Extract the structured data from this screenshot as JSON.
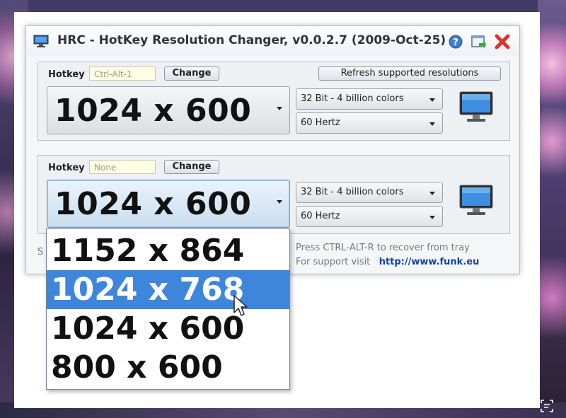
{
  "window": {
    "title": "HRC - HotKey Resolution Changer, v0.0.2.7 (2009-Oct-25)"
  },
  "panel1": {
    "hotkey_label": "Hotkey",
    "hotkey_value": "Ctrl-Alt-1",
    "change_label": "Change",
    "refresh_label": "Refresh supported resolutions",
    "resolution": "1024 x 600",
    "colors": "32 Bit - 4 billion colors",
    "hertz": "60 Hertz"
  },
  "panel2": {
    "hotkey_label": "Hotkey",
    "hotkey_value": "None",
    "change_label": "Change",
    "resolution": "1024 x 600",
    "colors": "32 Bit - 4 billion colors",
    "hertz": "60 Hertz"
  },
  "dropdown": {
    "options": [
      "1152 x 864",
      "1024 x 768",
      "1024 x 600",
      "800 x 600"
    ],
    "highlighted": "1024 x 768"
  },
  "footer": {
    "s_char": "S",
    "line1": "Press CTRL-ALT-R to recover from tray",
    "line2_prefix": "For support visit",
    "link": "http://www.funk.eu"
  },
  "icons": [
    "app-monitor-icon",
    "help-icon",
    "minimize-to-tray-icon",
    "close-icon",
    "monitor-icon",
    "mouse-pointer-icon",
    "scan-icon"
  ],
  "colors": {
    "highlight": "#3d86dc",
    "close": "#e0302a",
    "link": "#1540a8",
    "hotkey_field_bg": "#fdfde4"
  }
}
